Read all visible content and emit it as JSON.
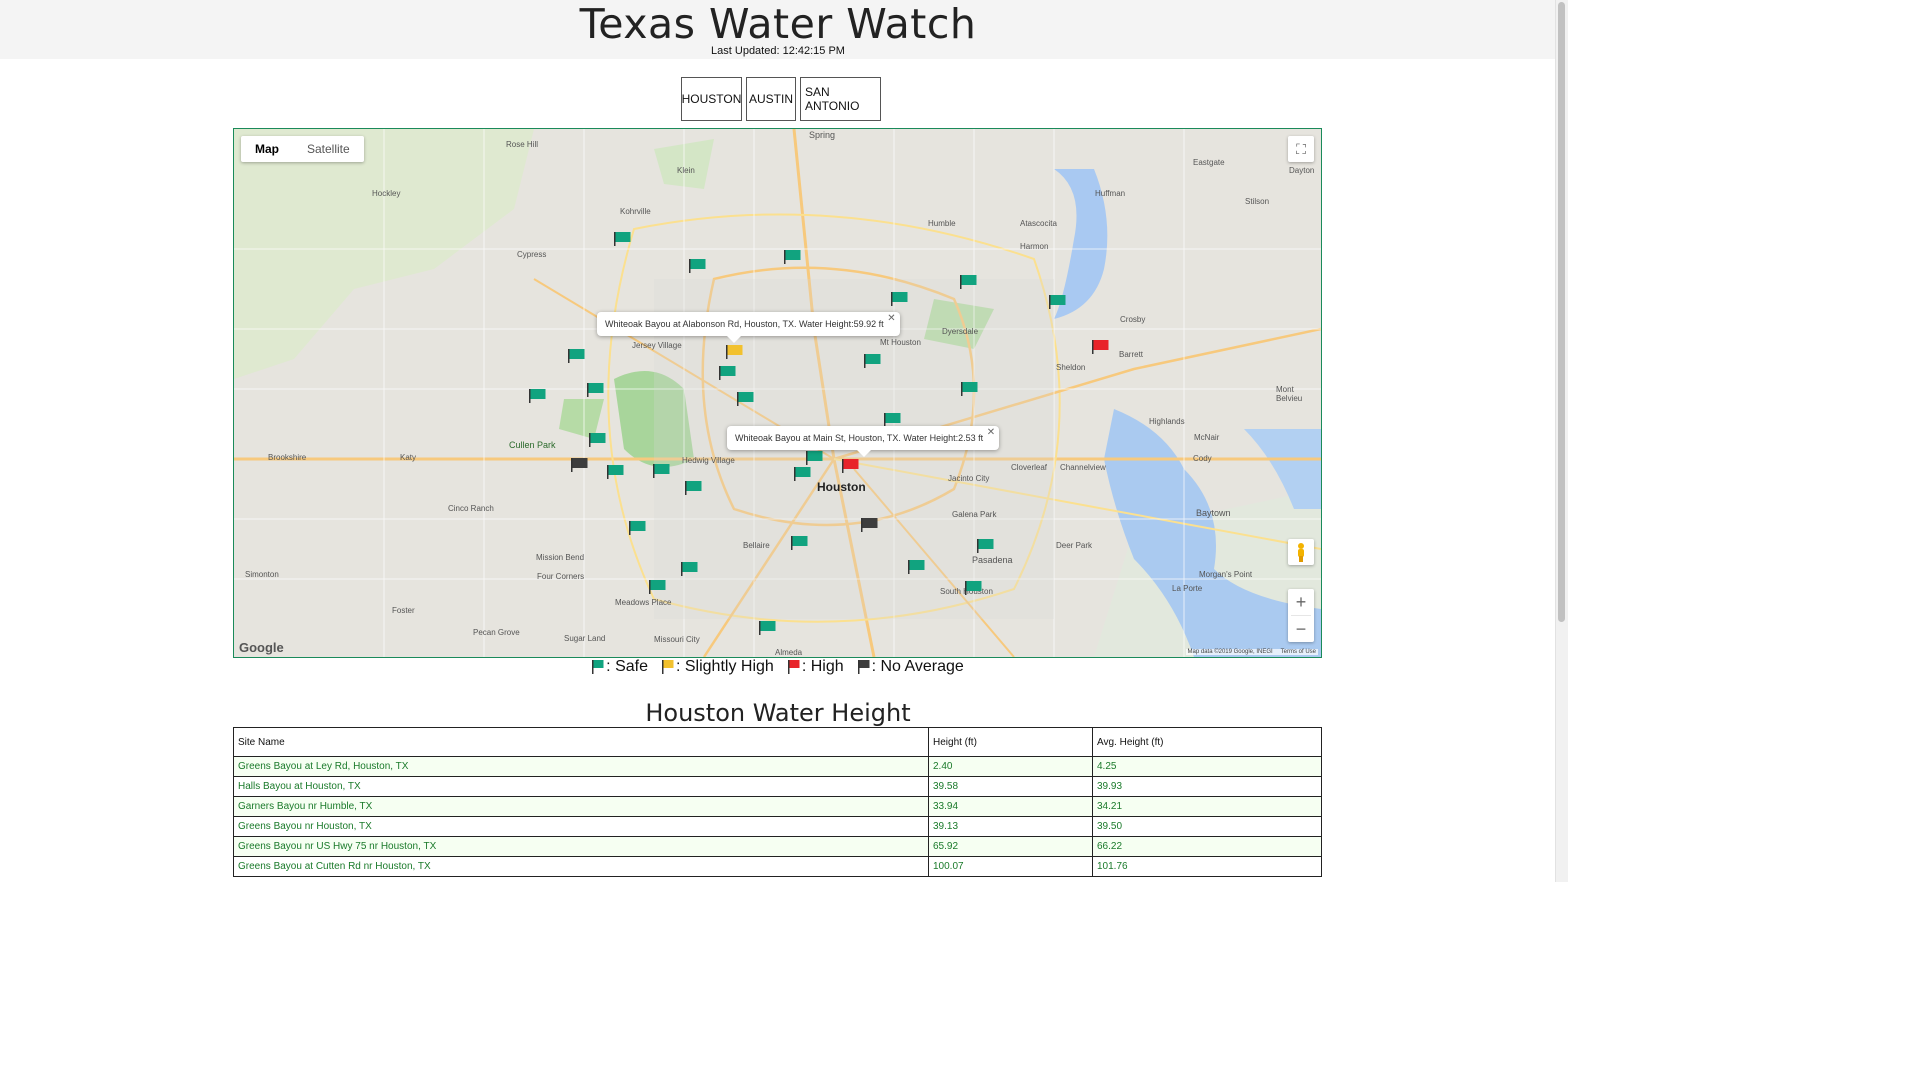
{
  "header": {
    "title": "Texas Water Watch",
    "last_updated": "Last Updated: 12:42:15 PM"
  },
  "cities": [
    "HOUSTON",
    "AUSTIN",
    "SAN ANTONIO"
  ],
  "map": {
    "type_controls": {
      "map": "Map",
      "satellite": "Satellite"
    },
    "logo": "Google",
    "attribution": "Map data ©2019 Google, INEGI",
    "terms": "Terms of Use",
    "labels": [
      "Spring",
      "Rose Hill",
      "Klein",
      "Hockley",
      "Kohrville",
      "Cypress",
      "Humble",
      "Atascocita",
      "Harmon",
      "Huffman",
      "Eastgate",
      "Dayton",
      "Stilson",
      "Crosby",
      "Barrett",
      "Mt Houston",
      "Dyersdale",
      "Jersey Village",
      "Sheldon",
      "Highlands",
      "McNair",
      "Mont Belvieu",
      "Cullen Park",
      "Katy",
      "Brookshire",
      "Hedwig Village",
      "Houston",
      "Channelview",
      "Cloverleaf",
      "Jacinto City",
      "Cody",
      "Baytown",
      "Cinco Ranch",
      "Galena Park",
      "Pasadena",
      "Deer Park",
      "Bellaire",
      "Mission Bend",
      "Four Corners",
      "Simonton",
      "Foster",
      "Meadows Place",
      "South Houston",
      "Morgan's Point",
      "La Porte",
      "Pecan Grove",
      "Sugar Land",
      "Missouri City",
      "Almeda"
    ],
    "colors": {
      "safe": "#11a37f",
      "slightly_high": "#f2c12e",
      "high": "#e8242a",
      "no_average": "#3d3d3d"
    },
    "info_windows": [
      {
        "text": "Whiteoak Bayou at Alabonson Rd, Houston, TX. Water Height:59.92 ft"
      },
      {
        "text": "Whiteoak Bayou at Main St, Houston, TX. Water Height:2.53 ft"
      }
    ]
  },
  "legend": [
    {
      "status": "safe",
      "label": ": Safe"
    },
    {
      "status": "slightly_high",
      "label": ": Slightly High"
    },
    {
      "status": "high",
      "label": ": High"
    },
    {
      "status": "no_average",
      "label": ": No Average"
    }
  ],
  "table": {
    "title": "Houston Water Height",
    "columns": [
      "Site Name",
      "Height (ft)",
      "Avg. Height (ft)"
    ],
    "rows": [
      [
        "Greens Bayou at Ley Rd, Houston, TX",
        "2.40",
        "4.25"
      ],
      [
        "Halls Bayou at Houston, TX",
        "39.58",
        "39.93"
      ],
      [
        "Garners Bayou nr Humble, TX",
        "33.94",
        "34.21"
      ],
      [
        "Greens Bayou nr Houston, TX",
        "39.13",
        "39.50"
      ],
      [
        "Greens Bayou nr US Hwy 75 nr Houston, TX",
        "65.92",
        "66.22"
      ],
      [
        "Greens Bayou at Cutten Rd nr Houston, TX",
        "100.07",
        "101.76"
      ]
    ]
  }
}
